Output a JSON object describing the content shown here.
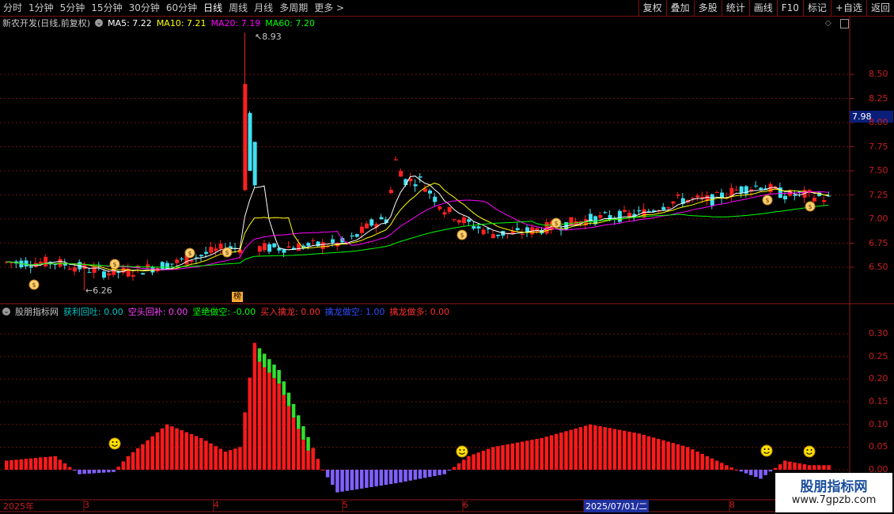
{
  "toolbar": {
    "periods": [
      "分时",
      "1分钟",
      "5分钟",
      "15分钟",
      "30分钟",
      "60分钟",
      "日线",
      "周线",
      "月线",
      "多周期",
      "更多 >"
    ],
    "active_period": "日线",
    "buttons": [
      "复权",
      "叠加",
      "多股",
      "统计",
      "画线",
      "F10",
      "标记",
      "+自选",
      "返回"
    ]
  },
  "main_chart": {
    "title": "新农开发(日线,前复权)",
    "ma": [
      {
        "label": "MA5: 7.22",
        "color": "#ffffff"
      },
      {
        "label": "MA10: 7.21",
        "color": "#ffff00"
      },
      {
        "label": "MA20: 7.19",
        "color": "#ff00ff"
      },
      {
        "label": "MA60: 7.20",
        "color": "#00ff00"
      }
    ],
    "y_ticks": [
      "8.50",
      "8.25",
      "8.00",
      "7.75",
      "7.50",
      "7.25",
      "7.00",
      "6.75",
      "6.50"
    ],
    "price_box": "7.98",
    "high_label": "8.93",
    "low_label": "6.26",
    "bang_label": "榜"
  },
  "indicator": {
    "title": "股朋指标网",
    "items": [
      {
        "label": "获利回吐: 0.00",
        "color": "#00c8c8"
      },
      {
        "label": "空头回补: 0.00",
        "color": "#ff40ff"
      },
      {
        "label": "坚绝做空: -0.00",
        "color": "#00ff00"
      },
      {
        "label": "买入擒龙: 0.00",
        "color": "#ff3030"
      },
      {
        "label": "擒龙做空: 1.00",
        "color": "#3050ff"
      },
      {
        "label": "擒龙做多: 0.00",
        "color": "#ff3030"
      }
    ],
    "y_ticks": [
      "0.30",
      "0.25",
      "0.20",
      "0.15",
      "0.10",
      "0.05",
      "0.00"
    ]
  },
  "x_axis": {
    "labels": [
      "2025年",
      "3",
      "4",
      "5",
      "6",
      "2025/07/01/二",
      "8"
    ],
    "highlight": "2025/07/01/二"
  },
  "watermark": {
    "line1": "股朋指标网",
    "line2": "www.7gpzb.com"
  },
  "chart_data": {
    "type": "candlestick",
    "title": "新农开发(日线,前复权)",
    "ylim": [
      6.3,
      9.0
    ],
    "high": 8.93,
    "low": 6.26,
    "ma": {
      "MA5": 7.22,
      "MA10": 7.21,
      "MA20": 7.19,
      "MA60": 7.2
    },
    "indicator_ylim": [
      -0.05,
      0.3
    ]
  }
}
